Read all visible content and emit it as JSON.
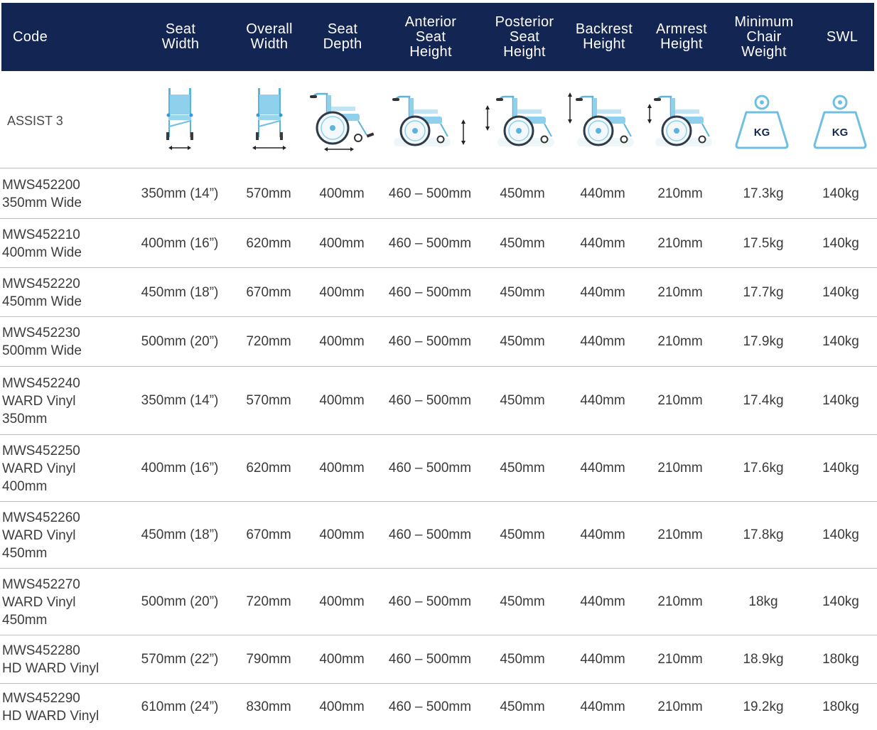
{
  "header": {
    "code": "Code",
    "seat_width": [
      "Seat",
      "Width"
    ],
    "overall_width": [
      "Overall",
      "Width"
    ],
    "seat_depth": [
      "Seat",
      "Depth"
    ],
    "anterior": [
      "Anterior",
      "Seat",
      "Height"
    ],
    "posterior": [
      "Posterior",
      "Seat",
      "Height"
    ],
    "backrest": [
      "Backrest",
      "Height"
    ],
    "armrest": [
      "Armrest",
      "Height"
    ],
    "min_weight": [
      "Minimum",
      "Chair",
      "Weight"
    ],
    "swl": "SWL"
  },
  "model": "ASSIST 3",
  "icons": {
    "kg_label": "KG",
    "names": [
      "seat-width-icon",
      "overall-width-icon",
      "seat-depth-icon",
      "anterior-seat-height-icon",
      "posterior-seat-height-icon",
      "backrest-height-icon",
      "armrest-height-icon",
      "chair-weight-icon",
      "swl-icon"
    ]
  },
  "colors": {
    "header_bg": "#132553",
    "chair_blue": "#8fd0ec",
    "frame_blue": "#5bb4dc",
    "kg_text": "#132553"
  },
  "rows": [
    {
      "code": [
        "MWS452200",
        "350mm Wide"
      ],
      "seat_width": "350mm (14”)",
      "overall_width": "570mm",
      "seat_depth": "400mm",
      "anterior": "460 – 500mm",
      "posterior": "450mm",
      "backrest": "440mm",
      "armrest": "210mm",
      "min_weight": "17.3kg",
      "swl": "140kg"
    },
    {
      "code": [
        "MWS452210",
        "400mm Wide"
      ],
      "seat_width": "400mm (16”)",
      "overall_width": "620mm",
      "seat_depth": "400mm",
      "anterior": "460 – 500mm",
      "posterior": "450mm",
      "backrest": "440mm",
      "armrest": "210mm",
      "min_weight": "17.5kg",
      "swl": "140kg"
    },
    {
      "code": [
        "MWS452220",
        "450mm Wide"
      ],
      "seat_width": "450mm (18”)",
      "overall_width": "670mm",
      "seat_depth": "400mm",
      "anterior": "460 – 500mm",
      "posterior": "450mm",
      "backrest": "440mm",
      "armrest": "210mm",
      "min_weight": "17.7kg",
      "swl": "140kg"
    },
    {
      "code": [
        "MWS452230",
        "500mm Wide"
      ],
      "seat_width": "500mm (20”)",
      "overall_width": "720mm",
      "seat_depth": "400mm",
      "anterior": "460 – 500mm",
      "posterior": "450mm",
      "backrest": "440mm",
      "armrest": "210mm",
      "min_weight": "17.9kg",
      "swl": "140kg"
    },
    {
      "code": [
        "MWS452240",
        "WARD Vinyl",
        "350mm"
      ],
      "seat_width": "350mm (14”)",
      "overall_width": "570mm",
      "seat_depth": "400mm",
      "anterior": "460 – 500mm",
      "posterior": "450mm",
      "backrest": "440mm",
      "armrest": "210mm",
      "min_weight": "17.4kg",
      "swl": "140kg"
    },
    {
      "code": [
        "MWS452250",
        "WARD Vinyl",
        "400mm"
      ],
      "seat_width": "400mm (16”)",
      "overall_width": "620mm",
      "seat_depth": "400mm",
      "anterior": "460 – 500mm",
      "posterior": "450mm",
      "backrest": "440mm",
      "armrest": "210mm",
      "min_weight": "17.6kg",
      "swl": "140kg"
    },
    {
      "code": [
        "MWS452260",
        "WARD Vinyl",
        "450mm"
      ],
      "seat_width": "450mm (18”)",
      "overall_width": "670mm",
      "seat_depth": "400mm",
      "anterior": "460 – 500mm",
      "posterior": "450mm",
      "backrest": "440mm",
      "armrest": "210mm",
      "min_weight": "17.8kg",
      "swl": "140kg"
    },
    {
      "code": [
        "MWS452270",
        "WARD Vinyl",
        "450mm"
      ],
      "seat_width": "500mm (20”)",
      "overall_width": "720mm",
      "seat_depth": "400mm",
      "anterior": "460 – 500mm",
      "posterior": "450mm",
      "backrest": "440mm",
      "armrest": "210mm",
      "min_weight": "18kg",
      "swl": "140kg"
    },
    {
      "code": [
        "MWS452280",
        "HD WARD Vinyl"
      ],
      "seat_width": "570mm (22”)",
      "overall_width": "790mm",
      "seat_depth": "400mm",
      "anterior": "460 – 500mm",
      "posterior": "450mm",
      "backrest": "440mm",
      "armrest": "210mm",
      "min_weight": "18.9kg",
      "swl": "180kg"
    },
    {
      "code": [
        "MWS452290",
        "HD WARD Vinyl"
      ],
      "seat_width": "610mm (24”)",
      "overall_width": "830mm",
      "seat_depth": "400mm",
      "anterior": "460 – 500mm",
      "posterior": "450mm",
      "backrest": "440mm",
      "armrest": "210mm",
      "min_weight": "19.2kg",
      "swl": "180kg"
    }
  ]
}
